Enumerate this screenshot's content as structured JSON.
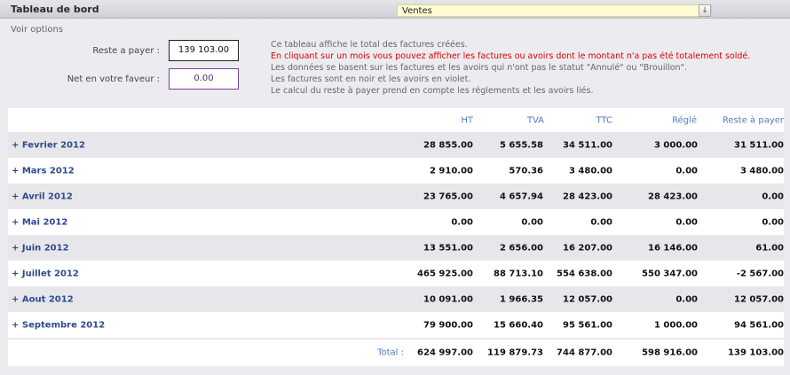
{
  "header": {
    "title": "Tableau de bord",
    "select_value": "Ventes",
    "select_arrow": "↓"
  },
  "options": {
    "link": "Voir options",
    "reste_label": "Reste a payer :",
    "reste_value": "139 103.00",
    "net_label": "Net en votre faveur :",
    "net_value": "0.00"
  },
  "info": [
    "Ce tableau affiche le total des factures créées.",
    "En cliquant sur un mois vous pouvez afficher les factures ou avoirs dont le montant n'a pas été totalement soldé.",
    "Les données se basent sur les factures et les avoirs qui n'ont pas le statut \"Annulé\" ou \"Brouillon\".",
    "Les factures sont en noir et les avoirs en violet.",
    "Le calcul du reste à payer prend en compte les réglements et les avoirs liés."
  ],
  "table": {
    "columns": [
      "HT",
      "TVA",
      "TTC",
      "Réglé",
      "Reste à payer"
    ],
    "rows": [
      {
        "month": "+ Fevrier 2012",
        "ht": "28 855.00",
        "tva": "5 655.58",
        "ttc": "34 511.00",
        "regle": "3 000.00",
        "reste": "31 511.00"
      },
      {
        "month": "+ Mars 2012",
        "ht": "2 910.00",
        "tva": "570.36",
        "ttc": "3 480.00",
        "regle": "0.00",
        "reste": "3 480.00"
      },
      {
        "month": "+ Avril 2012",
        "ht": "23 765.00",
        "tva": "4 657.94",
        "ttc": "28 423.00",
        "regle": "28 423.00",
        "reste": "0.00"
      },
      {
        "month": "+ Mai 2012",
        "ht": "0.00",
        "tva": "0.00",
        "ttc": "0.00",
        "regle": "0.00",
        "reste": "0.00"
      },
      {
        "month": "+ Juin 2012",
        "ht": "13 551.00",
        "tva": "2 656.00",
        "ttc": "16 207.00",
        "regle": "16 146.00",
        "reste": "61.00"
      },
      {
        "month": "+ Juillet 2012",
        "ht": "465 925.00",
        "tva": "88 713.10",
        "ttc": "554 638.00",
        "regle": "550 347.00",
        "reste": "-2 567.00"
      },
      {
        "month": "+ Aout 2012",
        "ht": "10 091.00",
        "tva": "1 966.35",
        "ttc": "12 057.00",
        "regle": "0.00",
        "reste": "12 057.00"
      },
      {
        "month": "+ Septembre 2012",
        "ht": "79 900.00",
        "tva": "15 660.40",
        "ttc": "95 561.00",
        "regle": "1 000.00",
        "reste": "94 561.00"
      }
    ],
    "total": {
      "label": "Total :",
      "ht": "624 997.00",
      "tva": "119 879.73",
      "ttc": "744 877.00",
      "regle": "598 916.00",
      "reste": "139 103.00"
    }
  }
}
